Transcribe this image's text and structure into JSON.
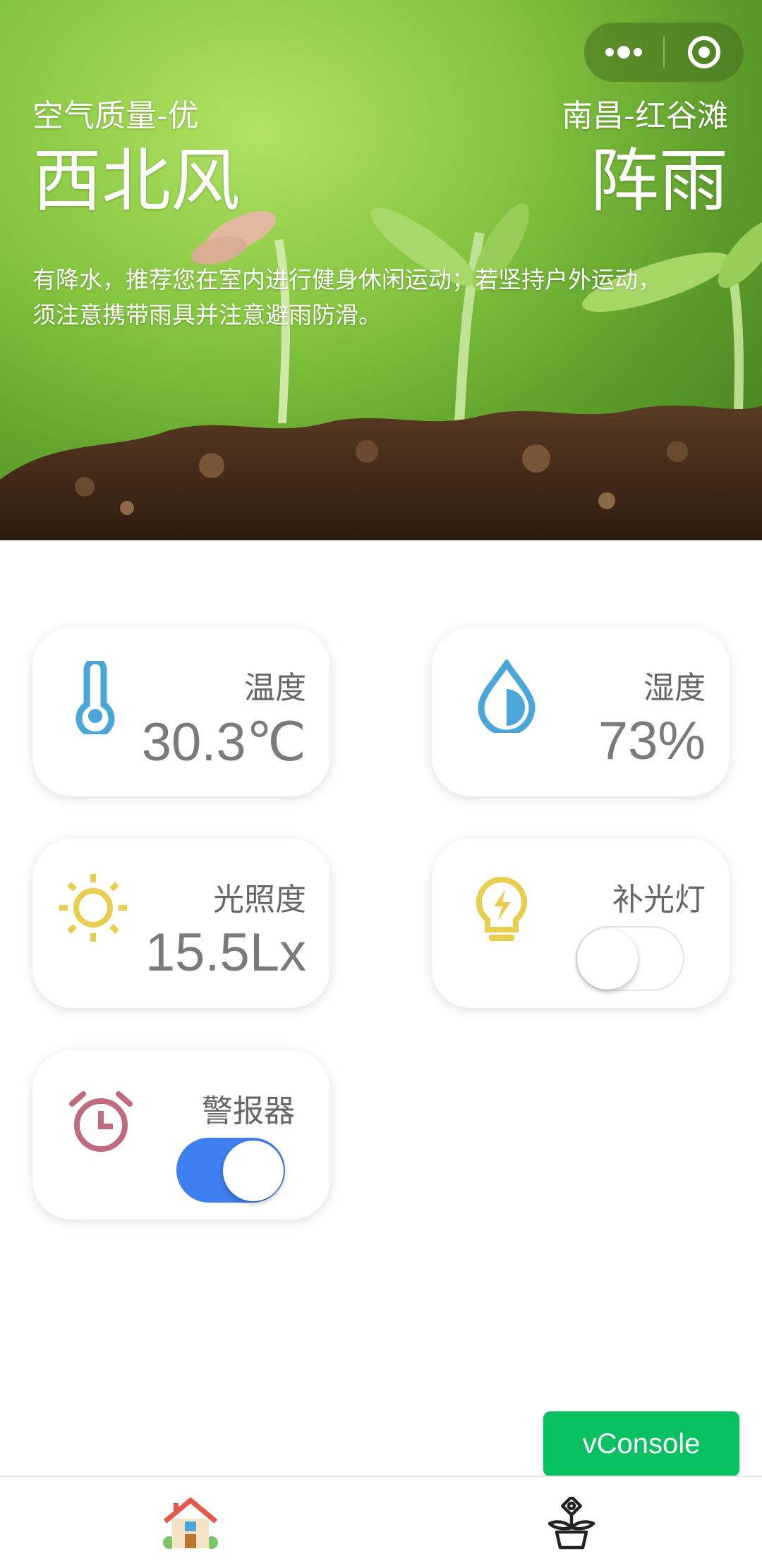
{
  "hero": {
    "air_quality": "空气质量-优",
    "location": "南昌-红谷滩",
    "wind": "西北风",
    "weather": "阵雨",
    "advice_line1": "有降水，推荐您在室内进行健身休闲运动；若坚持户外运动，",
    "advice_line2": "须注意携带雨具并注意避雨防滑。"
  },
  "capsule": {
    "more_icon": "more-dots-icon",
    "close_icon": "target-close-icon"
  },
  "cards": {
    "temperature": {
      "label": "温度",
      "value": "30.3℃",
      "icon": "thermometer-icon",
      "color": "#4aa6d8"
    },
    "humidity": {
      "label": "湿度",
      "value": "73%",
      "icon": "water-drop-icon",
      "color": "#4aa6d8"
    },
    "light": {
      "label": "光照度",
      "value": "15.5Lx",
      "icon": "sun-icon",
      "color": "#e8cd4e"
    },
    "fill_light": {
      "label": "补光灯",
      "state": "off",
      "icon": "lightbulb-icon",
      "color": "#e8cd4e"
    },
    "alarm": {
      "label": "警报器",
      "state": "on",
      "icon": "alarm-clock-icon",
      "color": "#c06a7e"
    }
  },
  "vconsole": {
    "label": "vConsole",
    "color": "#07c160"
  },
  "tabbar": {
    "tabs": [
      {
        "icon": "home-icon",
        "active": true
      },
      {
        "icon": "plant-pot-icon",
        "active": false
      }
    ]
  }
}
